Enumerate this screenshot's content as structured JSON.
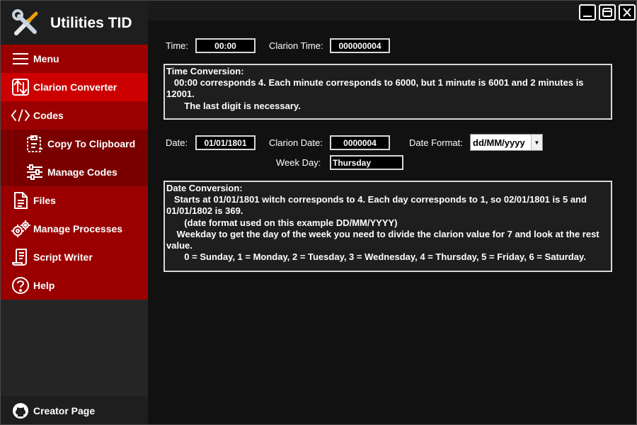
{
  "app": {
    "title": "Utilities TID"
  },
  "sidebar": {
    "items": [
      {
        "label": "Menu",
        "icon": "hamburger-icon"
      },
      {
        "label": "Clarion Converter",
        "icon": "convert-icon"
      },
      {
        "label": "Codes",
        "icon": "code-icon"
      },
      {
        "label": "Copy To Clipboard",
        "icon": "clipboard-icon"
      },
      {
        "label": "Manage Codes",
        "icon": "sliders-icon"
      },
      {
        "label": "Files",
        "icon": "file-icon"
      },
      {
        "label": "Manage Processes",
        "icon": "gears-icon"
      },
      {
        "label": "Script Writer",
        "icon": "script-icon"
      },
      {
        "label": "Help",
        "icon": "help-icon"
      }
    ],
    "creator": {
      "label": "Creator Page",
      "icon": "github-icon"
    }
  },
  "time": {
    "label": "Time:",
    "value": "00:00",
    "clarion_label": "Clarion Time:",
    "clarion_value": "000000004"
  },
  "time_conversion": {
    "heading": "Time Conversion:",
    "lines": [
      "   00:00 corresponds 4. Each minute corresponds to 6000, but 1 minute is 6001 and 2 minutes is 12001.",
      "       The last digit is necessary."
    ]
  },
  "date": {
    "label": "Date:",
    "value": "01/01/1801",
    "clarion_label": "Clarion Date:",
    "clarion_value": "0000004",
    "format_label": "Date Format:",
    "format_value": "dd/MM/yyyy",
    "weekday_label": "Week Day:",
    "weekday_value": "Thursday"
  },
  "date_conversion": {
    "heading": "Date Conversion:",
    "lines": [
      "   Starts at 01/01/1801 witch corresponds to 4. Each day corresponds to 1, so 02/01/1801 is 5 and 01/01/1802 is 369.",
      "       (date format used on this example DD/MM/YYYY)",
      "    Weekday to get the day of the week you need to divide the clarion value for 7 and look at the rest value.",
      "       0 = Sunday, 1 = Monday, 2 = Tuesday, 3 = Wednesday, 4 = Thursday, 5 = Friday, 6 = Saturday."
    ]
  },
  "colors": {
    "nav_red": "#9b0000",
    "nav_active": "#cc0000",
    "nav_sub": "#7a0000"
  }
}
